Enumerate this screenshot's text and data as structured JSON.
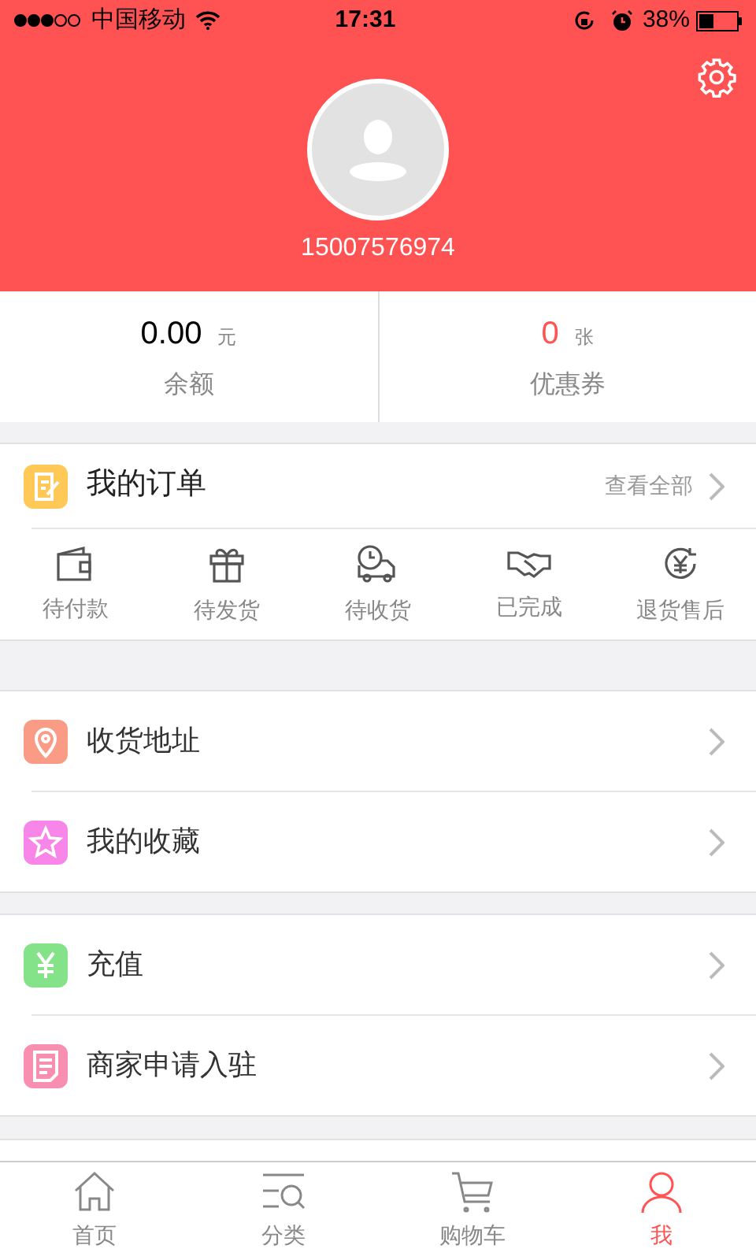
{
  "status_bar": {
    "carrier": "中国移动",
    "time": "17:31",
    "battery": "38%"
  },
  "profile": {
    "phone": "15007576974"
  },
  "stats": [
    {
      "value": "0.00",
      "unit": "元",
      "label": "余额",
      "kind": "money"
    },
    {
      "value": "0",
      "unit": "张",
      "label": "优惠券",
      "kind": "count"
    }
  ],
  "orders": {
    "title": "我的订单",
    "link": "查看全部",
    "items": [
      {
        "label": "待付款",
        "kind": "wallet"
      },
      {
        "label": "待发货",
        "kind": "gift"
      },
      {
        "label": "待收货",
        "kind": "truck"
      },
      {
        "label": "已完成",
        "kind": "handshake"
      },
      {
        "label": "退货售后",
        "kind": "refund"
      }
    ]
  },
  "menu_groups": [
    [
      {
        "label": "收货地址",
        "kind": "location",
        "color": "#f99b85"
      },
      {
        "label": "我的收藏",
        "kind": "star",
        "color": "#f786e8"
      }
    ],
    [
      {
        "label": "充值",
        "kind": "yuan",
        "color": "#84e389"
      },
      {
        "label": "商家申请入驻",
        "kind": "document",
        "color": "#f98fb0"
      }
    ]
  ],
  "tab_bar": [
    {
      "label": "首页",
      "kind": "home",
      "selected": false
    },
    {
      "label": "分类",
      "kind": "category",
      "selected": false
    },
    {
      "label": "购物车",
      "kind": "cart",
      "selected": false
    },
    {
      "label": "我",
      "kind": "person",
      "selected": true
    }
  ]
}
